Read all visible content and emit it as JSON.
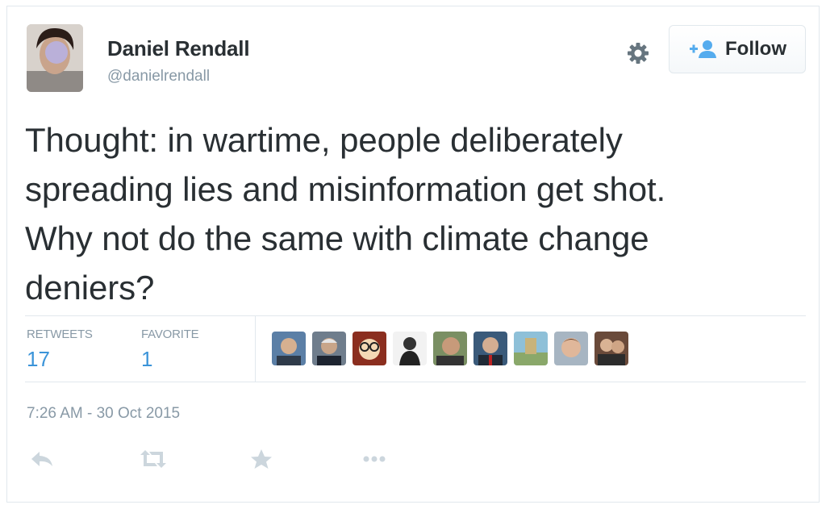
{
  "user": {
    "name": "Daniel Rendall",
    "handle": "@danielrendall"
  },
  "follow_button": {
    "label": "Follow",
    "icon": "follow-person-icon"
  },
  "settings": {
    "icon": "gear-icon"
  },
  "tweet": {
    "text_lines": [
      "Thought: in wartime, people deliberately",
      "spreading lies and misinformation get shot.",
      "Why not do the same with climate change",
      "deniers?"
    ]
  },
  "stats": {
    "retweets_label": "RETWEETS",
    "retweets_value": "17",
    "favorites_label": "FAVORITE",
    "favorites_value": "1"
  },
  "engagers": [
    {
      "icon": "avatar-1"
    },
    {
      "icon": "avatar-2"
    },
    {
      "icon": "avatar-3"
    },
    {
      "icon": "avatar-4"
    },
    {
      "icon": "avatar-5"
    },
    {
      "icon": "avatar-6"
    },
    {
      "icon": "avatar-7"
    },
    {
      "icon": "avatar-8"
    },
    {
      "icon": "avatar-9"
    }
  ],
  "timestamp": "7:26 AM - 30 Oct 2015",
  "actions": [
    {
      "icon": "reply-icon"
    },
    {
      "icon": "retweet-icon"
    },
    {
      "icon": "favorite-star-icon"
    },
    {
      "icon": "more-icon"
    }
  ],
  "colors": {
    "text": "#292f33",
    "muted": "#8899a6",
    "link": "#3b94d9",
    "border": "#e1e8ed",
    "icon": "#ccd6dd"
  }
}
